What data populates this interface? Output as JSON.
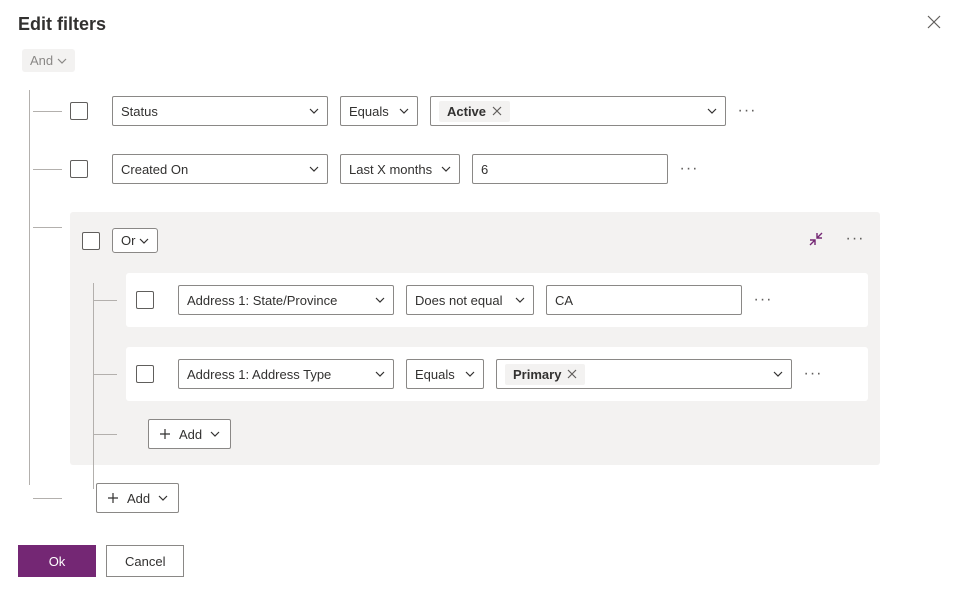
{
  "dialog": {
    "title": "Edit filters"
  },
  "root": {
    "op": "And",
    "rows": [
      {
        "field": "Status",
        "operator": "Equals",
        "value_chip": "Active"
      },
      {
        "field": "Created On",
        "operator": "Last X months",
        "value_text": "6"
      }
    ],
    "group": {
      "op": "Or",
      "rows": [
        {
          "field": "Address 1: State/Province",
          "operator": "Does not equal",
          "value_text": "CA"
        },
        {
          "field": "Address 1: Address Type",
          "operator": "Equals",
          "value_chip": "Primary"
        }
      ],
      "add_label": "Add"
    },
    "add_label": "Add"
  },
  "footer": {
    "ok": "Ok",
    "cancel": "Cancel"
  }
}
